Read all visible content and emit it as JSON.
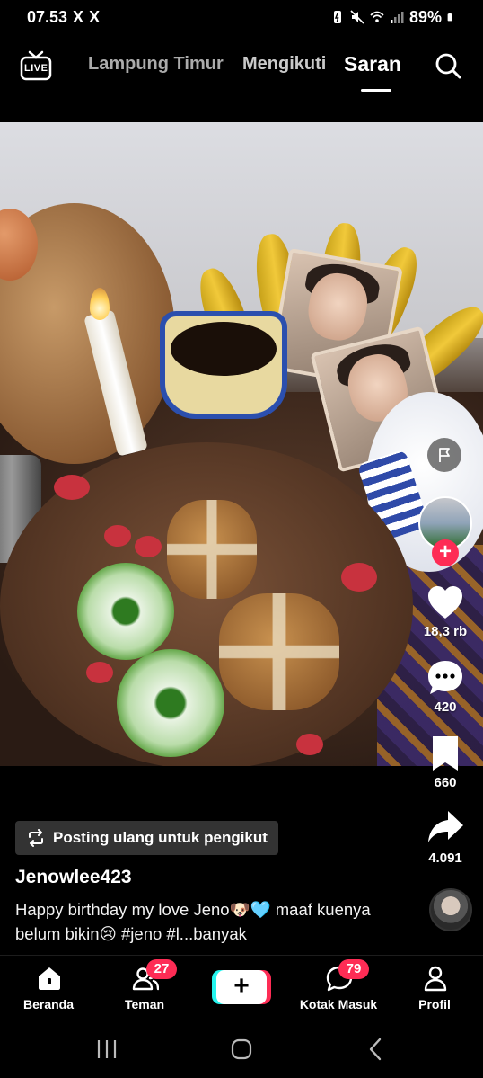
{
  "status_bar": {
    "time": "07.53",
    "x_icons": [
      "X",
      "X"
    ],
    "battery": "89%"
  },
  "top_nav": {
    "live_label": "LIVE",
    "tabs": [
      {
        "label": "Lampung Timur",
        "active": false
      },
      {
        "label": "Mengikuti",
        "active": false
      },
      {
        "label": "Saran",
        "active": true
      }
    ]
  },
  "actions": {
    "likes": "18,3 rb",
    "comments": "420",
    "saves": "660",
    "shares": "4.091"
  },
  "post": {
    "repost_label": "Posting ulang untuk pengikut",
    "username": "Jenowlee423",
    "caption": "Happy birthday my love Jeno🐶🩵 maaf kuenya belum bikin😢 #jeno #l...banyak"
  },
  "bottom_nav": {
    "items": [
      {
        "label": "Beranda",
        "icon": "home-icon"
      },
      {
        "label": "Teman",
        "icon": "friends-icon",
        "badge": "27"
      },
      {
        "label": "Kotak Masuk",
        "icon": "inbox-icon",
        "badge": "79"
      },
      {
        "label": "Profil",
        "icon": "profile-icon"
      }
    ]
  },
  "colors": {
    "accent_red": "#fe2c55",
    "accent_cyan": "#25f4ee",
    "background": "#000000"
  }
}
